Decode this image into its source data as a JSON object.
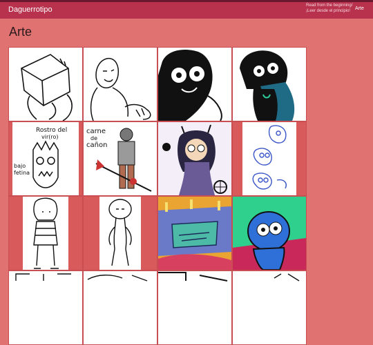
{
  "header": {
    "site_title": "Daguerrotipo",
    "read_line1": "Read from the beginning/",
    "read_line2": "¡Leer desde el principio!",
    "nav_arte": "Arte"
  },
  "page": {
    "title": "Arte"
  },
  "gallery": {
    "items": [
      {
        "alt": "sketch of a figure carrying a box on its head"
      },
      {
        "alt": "sketch of a bald old man relaxing"
      },
      {
        "alt": "black and white girl with long dark hair"
      },
      {
        "alt": "girl with dark hair and teal cape"
      },
      {
        "alt": "Rostro del vir(ro)"
      },
      {
        "alt": "Carne de cañón"
      },
      {
        "alt": "horned girl with purple dress"
      },
      {
        "alt": "blue skull sketches"
      },
      {
        "alt": "child figure sketch"
      },
      {
        "alt": "bald thin figure sketch"
      },
      {
        "alt": "colorful castle scene"
      },
      {
        "alt": "blue creature on green background"
      }
    ],
    "text_rostro_line1": "Rostro del",
    "text_rostro_line2": "vir(ro)",
    "text_bajo_line1": "bajo",
    "text_bajo_line2": "fetina",
    "text_carne_line1": "carne",
    "text_carne_line2": "de",
    "text_carne_line3": "cañon"
  }
}
